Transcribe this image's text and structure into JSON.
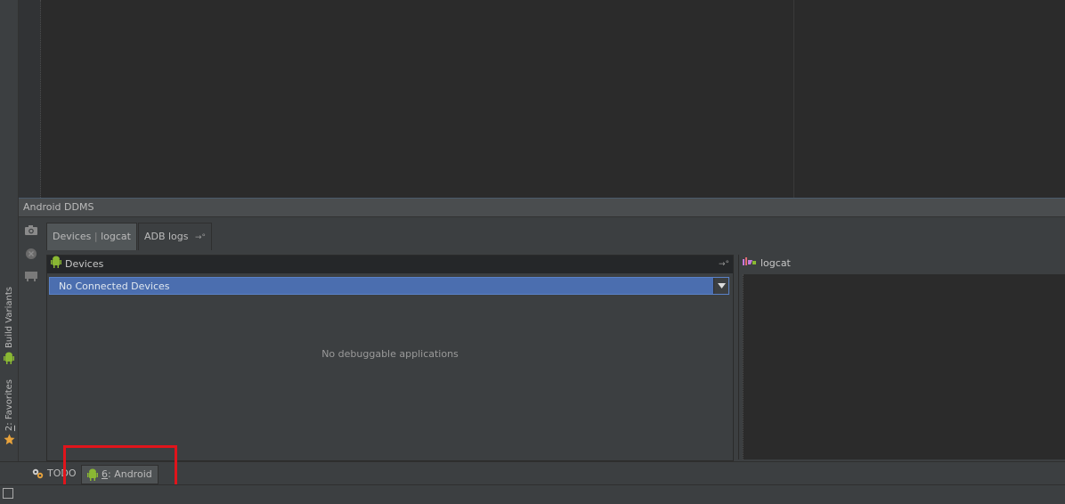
{
  "left_strip": {
    "build_variants": {
      "label": "Build Variants",
      "icon": "android-icon"
    },
    "favorites": {
      "num": "2",
      "label": ": Favorites",
      "icon": "star-icon"
    }
  },
  "ddms": {
    "title": "Android DDMS",
    "tools": [
      "camera-icon",
      "stop-icon",
      "device-icon"
    ],
    "tabs": [
      {
        "label_a": "Devices",
        "sep": "|",
        "label_b": "logcat",
        "active": true
      },
      {
        "label": "ADB logs",
        "pin": "→°",
        "active": false
      }
    ],
    "devices": {
      "title": "Devices",
      "pin": "→°",
      "dropdown_value": "No Connected Devices",
      "empty_message": "No debuggable applications"
    },
    "logcat": {
      "title": "logcat"
    }
  },
  "bottom_bar": {
    "todo": {
      "label": "TODO"
    },
    "android": {
      "num": "6",
      "label": ": Android"
    }
  },
  "colors": {
    "highlight": "#e0141b",
    "android_green": "#8ab833",
    "dropdown": "#4b6eaf"
  }
}
